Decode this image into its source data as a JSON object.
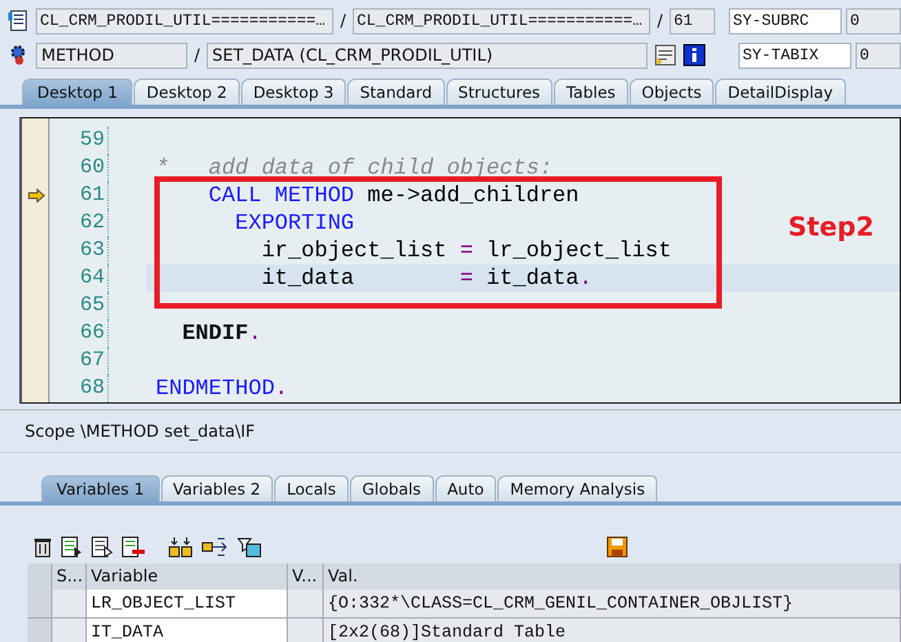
{
  "header": {
    "row1": {
      "include": "CL_CRM_PRODIL_UTIL===========…",
      "program": "CL_CRM_PRODIL_UTIL===========…",
      "line": "61",
      "sysfield": "SY-SUBRC",
      "sysvalue": "0"
    },
    "row2": {
      "event_type": "METHOD",
      "event": "SET_DATA (CL_CRM_PRODIL_UTIL)",
      "sysfield": "SY-TABIX",
      "sysvalue": "0"
    },
    "separator": "/"
  },
  "desktop_tabs": [
    {
      "label": "Desktop 1",
      "selected": true
    },
    {
      "label": "Desktop 2",
      "selected": false
    },
    {
      "label": "Desktop 3",
      "selected": false
    },
    {
      "label": "Standard",
      "selected": false
    },
    {
      "label": "Structures",
      "selected": false
    },
    {
      "label": "Tables",
      "selected": false
    },
    {
      "label": "Objects",
      "selected": false
    },
    {
      "label": "DetailDisplay",
      "selected": false
    }
  ],
  "code": [
    {
      "number": "59",
      "current": false,
      "highlighted": false
    },
    {
      "number": "60",
      "current": false,
      "highlighted": false,
      "tokens": [
        {
          "kind": "comment",
          "text": "*   add data of child objects:"
        }
      ]
    },
    {
      "number": "61",
      "current": true,
      "highlighted": false,
      "tokens": [
        {
          "kind": "keyword",
          "text": "    CALL METHOD"
        },
        {
          "kind": "text",
          "text": " me->add_children"
        }
      ]
    },
    {
      "number": "62",
      "current": false,
      "highlighted": false,
      "tokens": [
        {
          "kind": "keyword",
          "text": "      EXPORTING"
        }
      ]
    },
    {
      "number": "63",
      "current": false,
      "highlighted": false,
      "tokens": [
        {
          "kind": "text",
          "text": "        ir_object_list "
        },
        {
          "kind": "operator",
          "text": "="
        },
        {
          "kind": "text",
          "text": " lr_object_list"
        }
      ]
    },
    {
      "number": "64",
      "current": false,
      "highlighted": true,
      "tokens": [
        {
          "kind": "text",
          "text": "        it_data        "
        },
        {
          "kind": "operator",
          "text": "="
        },
        {
          "kind": "text",
          "text": " it_data"
        },
        {
          "kind": "operator",
          "text": "."
        }
      ]
    },
    {
      "number": "65",
      "current": false,
      "highlighted": false
    },
    {
      "number": "66",
      "current": false,
      "highlighted": false,
      "tokens": [
        {
          "kind": "bold",
          "text": "  ENDIF"
        },
        {
          "kind": "operator",
          "text": "."
        }
      ]
    },
    {
      "number": "67",
      "current": false,
      "highlighted": false
    },
    {
      "number": "68",
      "current": false,
      "highlighted": false,
      "tokens": [
        {
          "kind": "keyword",
          "text": "ENDMETHOD"
        },
        {
          "kind": "operator",
          "text": "."
        }
      ]
    }
  ],
  "annotation": {
    "label": "Step2"
  },
  "scope": "Scope \\METHOD set_data\\IF",
  "variable_tabs": [
    {
      "label": "Variables 1",
      "selected": true
    },
    {
      "label": "Variables 2",
      "selected": false
    },
    {
      "label": "Locals",
      "selected": false
    },
    {
      "label": "Globals",
      "selected": false
    },
    {
      "label": "Auto",
      "selected": false
    },
    {
      "label": "Memory Analysis",
      "selected": false
    }
  ],
  "table": {
    "columns": [
      "S...",
      "Variable",
      "V...",
      "Val."
    ],
    "rows": [
      {
        "variable": "LR_OBJECT_LIST",
        "value": "{O:332*\\CLASS=CL_CRM_GENIL_CONTAINER_OBJLIST}"
      },
      {
        "variable": "IT_DATA",
        "value": "[2x2(68)]Standard Table"
      }
    ]
  }
}
